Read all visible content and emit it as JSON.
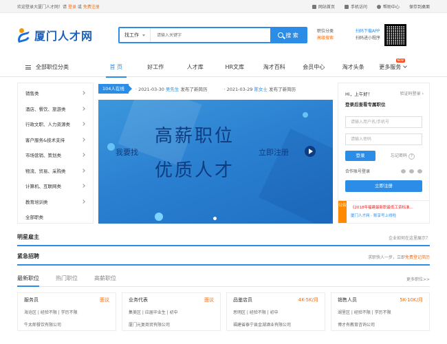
{
  "topbar": {
    "welcome_prefix": "欢迎登录大厦门人才网！请",
    "login": "登录",
    "or": "或",
    "register": "免费注册",
    "links": [
      "网站首页",
      "手机访问",
      "帮助中心",
      "保存到桌面"
    ]
  },
  "header": {
    "logo_text": "厦门人才网",
    "search_type": "找工作",
    "search_placeholder": "请输入关键字",
    "search_button": "搜 索",
    "link1": "职位分类",
    "link2": "高级搜索",
    "app_line1": "扫码下载APP",
    "app_line2": "扫码进小程序"
  },
  "nav": {
    "all_categories": "全部职位分类",
    "items": [
      "首 页",
      "好工作",
      "人才库",
      "HR文库",
      "淘才百科",
      "会员中心",
      "淘才头条",
      "更多服务"
    ],
    "new_badge": "NEW"
  },
  "categories": [
    "销售类",
    "酒店、餐饮、旅游类",
    "行政文职、人力资源类",
    "客户服务&技术支持",
    "市场营销、策划类",
    "物流、贸易、采购类",
    "计算机、互联网类",
    "教育培训类",
    "全部职类"
  ],
  "ticker": {
    "online": "104人在线",
    "entries": [
      {
        "date": "2021-03-30",
        "name": "吴先生",
        "action": "发布了新简历"
      },
      {
        "date": "2021-03-29",
        "name": "陈女士",
        "action": "发布了新简历"
      }
    ]
  },
  "banner": {
    "left": "我要找",
    "line1": "高薪职位",
    "line2": "优质人才",
    "right": "立即注册"
  },
  "login": {
    "greeting": "Hi，上午好！",
    "verify_login": "验证码登录",
    "subtitle": "登录后查看专属职位",
    "username_placeholder": "请输入用户名/手机号",
    "password_placeholder": "请输入密码",
    "login_button": "登录",
    "forgot": "忘记密码",
    "partner_login": "合作账号登录",
    "register_button": "立即注册",
    "notice_tag": "公告",
    "notice1": "《2018年福建最新职最低工资标准...",
    "notice2": "厦门人才网 - 账享号上线啦"
  },
  "sections": {
    "star_title": "明星雇主",
    "star_right": "企业如何在这里展示？",
    "urgent_title": "紧急招聘",
    "urgent_right_prefix": "求职快人一步，立即",
    "urgent_right_link": "免费登记简历"
  },
  "tabs": {
    "items": [
      "最新职位",
      "热门职位",
      "高薪职位"
    ],
    "more": "更多职位>>"
  },
  "jobs": [
    {
      "name": "服务员",
      "pay": "面议",
      "req": "海沧区 | 经验不限 | 学历不限",
      "company": "牛太郎餐饮有限公司"
    },
    {
      "name": "业务代表",
      "pay": "面议",
      "req": "集美区 | 应届毕业生 | 初中",
      "company": "厦门元复商贸有限公司"
    },
    {
      "name": "品鉴店员",
      "pay": "4K-5K/月",
      "req": "思明区 | 经验不限 | 初中",
      "company": "福建省泰宁县金湖酒业有限公司"
    },
    {
      "name": "销售人员",
      "pay": "5K-10K/月",
      "req": "湖里区 | 经验不限 | 学历不限",
      "company": "博才有教育咨询公司"
    }
  ]
}
